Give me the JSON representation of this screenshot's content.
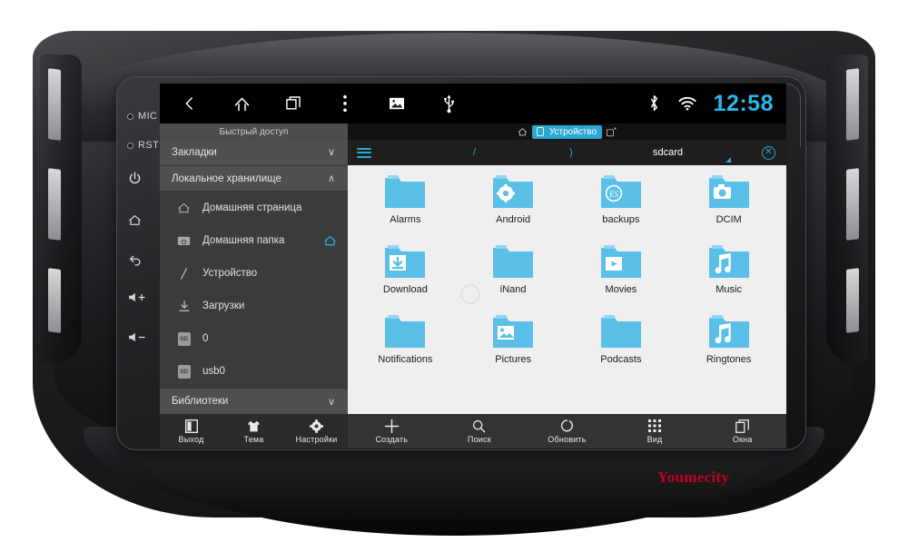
{
  "device": {
    "brand_watermark": "Youmecity",
    "physical_keys": [
      {
        "name": "mic",
        "label": "MIC",
        "type": "led"
      },
      {
        "name": "reset",
        "label": "RST",
        "type": "led"
      },
      {
        "name": "power",
        "label": "",
        "glyph": "⏻",
        "type": "glyph"
      },
      {
        "name": "home",
        "label": "",
        "glyph": "⌂",
        "type": "glyph"
      },
      {
        "name": "back",
        "label": "",
        "glyph": "↶",
        "type": "glyph"
      },
      {
        "name": "volume-up",
        "label": "+",
        "glyph": "🔈",
        "type": "glyph"
      },
      {
        "name": "volume-down",
        "label": "−",
        "glyph": "🔈",
        "type": "glyph"
      }
    ]
  },
  "statusbar": {
    "nav_icons": [
      "back-icon",
      "home-icon",
      "recents-icon",
      "overflow-menu-icon",
      "gallery-icon",
      "usb-icon"
    ],
    "bluetooth_icon": "bluetooth-icon",
    "wifi_icon": "wifi-icon",
    "clock": "12:58",
    "clock_color": "#29b6e8"
  },
  "tabs": {
    "sidebar_title": "Быстрый доступ",
    "home_icon": "home-icon",
    "active_tab": "Устройство",
    "active_tab_color": "#2aa8cf",
    "add_tab_icon": "new-tab-icon"
  },
  "sidebar": {
    "groups": [
      {
        "label": "Закладки",
        "state": "collapsed",
        "chevron": "∨"
      },
      {
        "label": "Локальное хранилище",
        "state": "expanded",
        "chevron": "∧"
      }
    ],
    "items": [
      {
        "label": "Домашняя страница",
        "icon": "home-outline-icon",
        "trailing": null
      },
      {
        "label": "Домашняя папка",
        "icon": "folder-home-icon",
        "trailing": "home-accent-icon"
      },
      {
        "label": "Устройство",
        "icon": "root-slash-icon",
        "trailing": null
      },
      {
        "label": "Загрузки",
        "icon": "download-icon",
        "trailing": null
      },
      {
        "label": "0",
        "icon": "sd-card-icon",
        "trailing": null
      },
      {
        "label": "usb0",
        "icon": "sd-card-icon",
        "trailing": null
      }
    ],
    "footer_group": {
      "label": "Библиотеки",
      "state": "collapsed",
      "chevron": "∨"
    }
  },
  "pathbar": {
    "menu_icon": "hamburger-icon",
    "segments": [
      {
        "label": "/",
        "current": false
      },
      {
        "label": ")",
        "current": false
      },
      {
        "label": "sdcard",
        "current": true
      }
    ],
    "close_icon": "close-circle-icon",
    "accent_color": "#2aa8cf"
  },
  "files": [
    {
      "name": "Alarms",
      "type": "folder",
      "badge": "none"
    },
    {
      "name": "Android",
      "type": "folder",
      "badge": "gear-icon"
    },
    {
      "name": "backups",
      "type": "folder",
      "badge": "es-logo-icon"
    },
    {
      "name": "DCIM",
      "type": "folder",
      "badge": "camera-icon"
    },
    {
      "name": "Download",
      "type": "folder",
      "badge": "download-icon"
    },
    {
      "name": "iNand",
      "type": "folder",
      "badge": "none"
    },
    {
      "name": "Movies",
      "type": "folder",
      "badge": "play-icon"
    },
    {
      "name": "Music",
      "type": "folder",
      "badge": "music-note-icon"
    },
    {
      "name": "Notifications",
      "type": "folder",
      "badge": "none"
    },
    {
      "name": "Pictures",
      "type": "folder",
      "badge": "photo-icon"
    },
    {
      "name": "Podcasts",
      "type": "folder",
      "badge": "none"
    },
    {
      "name": "Ringtones",
      "type": "folder",
      "badge": "music-note-icon"
    }
  ],
  "folder_color": "#5bc0e8",
  "toolbar_left": [
    {
      "label": "Выход",
      "icon": "exit-icon"
    },
    {
      "label": "Тема",
      "icon": "theme-shirt-icon"
    },
    {
      "label": "Настройки",
      "icon": "gear-icon"
    }
  ],
  "toolbar_right": [
    {
      "label": "Создать",
      "icon": "plus-icon"
    },
    {
      "label": "Поиск",
      "icon": "search-icon"
    },
    {
      "label": "Обновить",
      "icon": "refresh-icon"
    },
    {
      "label": "Вид",
      "icon": "grid-view-icon"
    },
    {
      "label": "Окна",
      "icon": "windows-icon"
    }
  ]
}
